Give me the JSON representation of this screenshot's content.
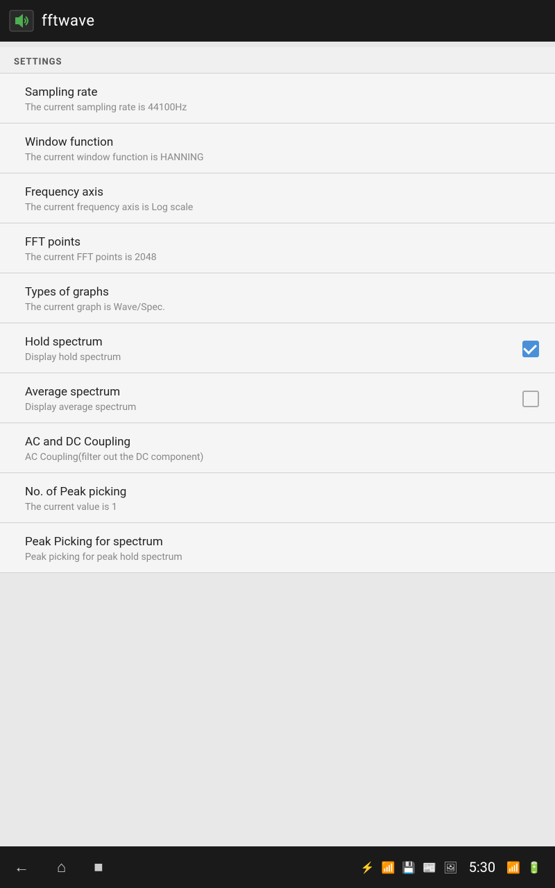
{
  "topbar": {
    "title": "fftwave"
  },
  "settings": {
    "header": "SETTINGS",
    "items": [
      {
        "id": "sampling-rate",
        "title": "Sampling rate",
        "subtitle": "The current sampling rate is 44100Hz",
        "has_checkbox": false
      },
      {
        "id": "window-function",
        "title": "Window function",
        "subtitle": "The current window function is HANNING",
        "has_checkbox": false
      },
      {
        "id": "frequency-axis",
        "title": "Frequency axis",
        "subtitle": "The current frequency axis is Log scale",
        "has_checkbox": false
      },
      {
        "id": "fft-points",
        "title": "FFT points",
        "subtitle": "The current FFT points is 2048",
        "has_checkbox": false
      },
      {
        "id": "types-of-graphs",
        "title": "Types of graphs",
        "subtitle": "The current graph is Wave/Spec.",
        "has_checkbox": false
      },
      {
        "id": "hold-spectrum",
        "title": "Hold spectrum",
        "subtitle": "Display hold spectrum",
        "has_checkbox": true,
        "checked": true
      },
      {
        "id": "average-spectrum",
        "title": "Average spectrum",
        "subtitle": "Display average spectrum",
        "has_checkbox": true,
        "checked": false
      },
      {
        "id": "ac-dc-coupling",
        "title": "AC and DC Coupling",
        "subtitle": "AC Coupling(filter out the DC component)",
        "has_checkbox": false
      },
      {
        "id": "peak-picking-no",
        "title": "No. of Peak picking",
        "subtitle": "The current value is 1",
        "has_checkbox": false
      },
      {
        "id": "peak-picking-spectrum",
        "title": "Peak Picking for spectrum",
        "subtitle": "Peak picking for peak hold spectrum",
        "has_checkbox": false
      }
    ]
  },
  "statusbar": {
    "time": "5:30"
  }
}
